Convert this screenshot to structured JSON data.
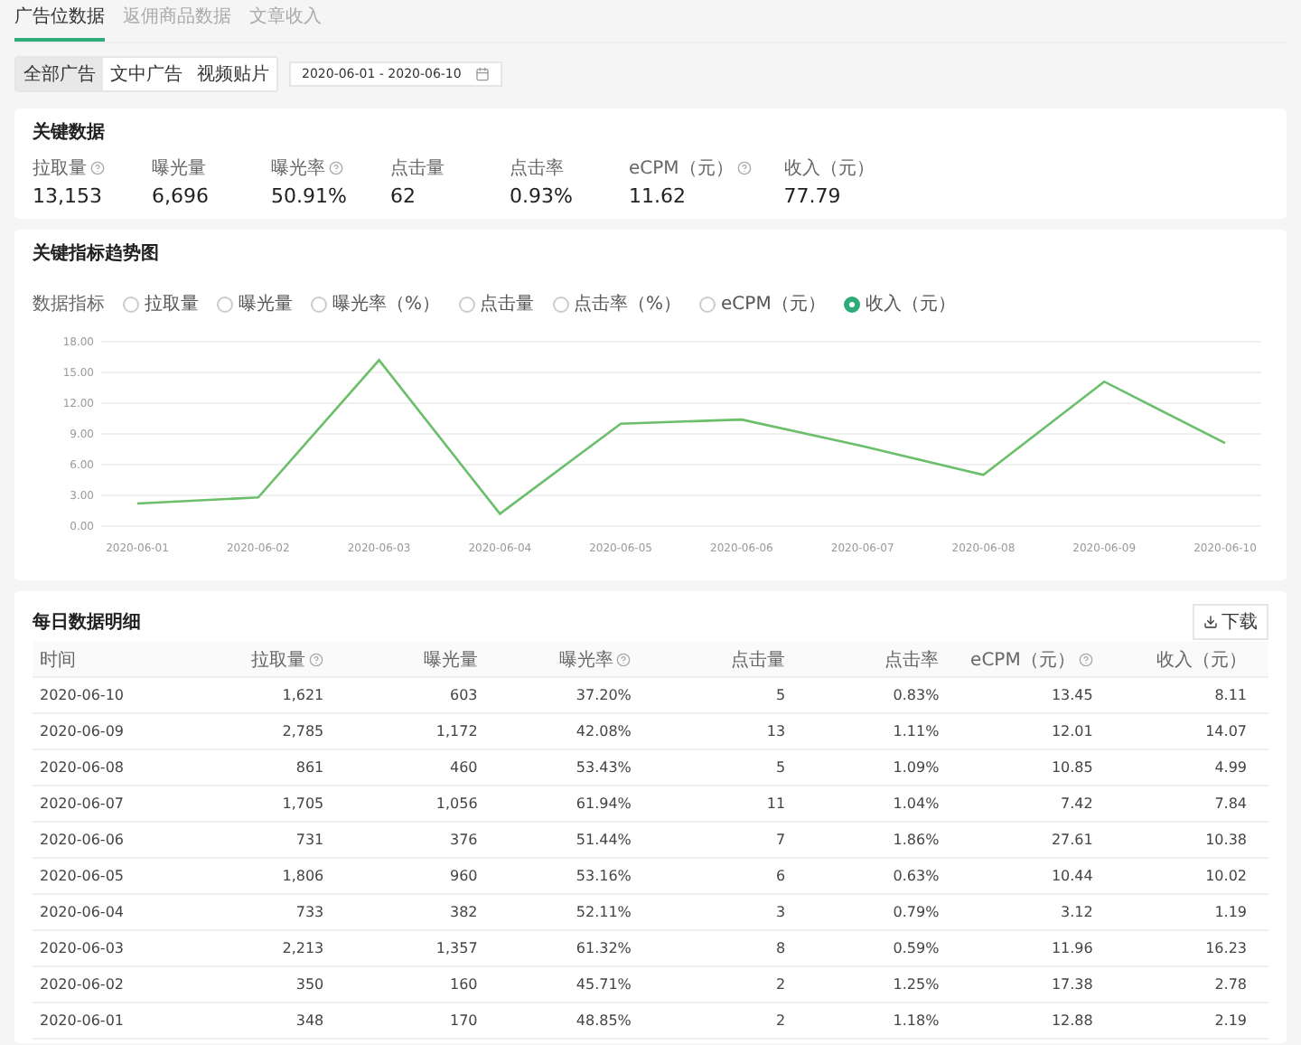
{
  "tabs": [
    {
      "label": "广告位数据",
      "selected": true
    },
    {
      "label": "返佣商品数据",
      "selected": false
    },
    {
      "label": "文章收入",
      "selected": false
    }
  ],
  "filters": {
    "ad_types": [
      {
        "label": "全部广告",
        "selected": true
      },
      {
        "label": "文中广告",
        "selected": false
      },
      {
        "label": "视频贴片",
        "selected": false
      }
    ],
    "date_range": "2020-06-01 - 2020-06-10"
  },
  "key_data": {
    "title": "关键数据",
    "metrics": [
      {
        "label": "拉取量",
        "help": true,
        "value": "13,153"
      },
      {
        "label": "曝光量",
        "help": false,
        "value": "6,696"
      },
      {
        "label": "曝光率",
        "help": true,
        "value": "50.91%"
      },
      {
        "label": "点击量",
        "help": false,
        "value": "62"
      },
      {
        "label": "点击率",
        "help": false,
        "value": "0.93%"
      },
      {
        "label": "eCPM（元）",
        "help": true,
        "value": "11.62"
      },
      {
        "label": "收入（元）",
        "help": false,
        "value": "77.79"
      }
    ]
  },
  "trend": {
    "title": "关键指标趋势图",
    "indicator_label": "数据指标",
    "indicators": [
      {
        "label": "拉取量",
        "selected": false
      },
      {
        "label": "曝光量",
        "selected": false
      },
      {
        "label": "曝光率（%）",
        "selected": false
      },
      {
        "label": "点击量",
        "selected": false
      },
      {
        "label": "点击率（%）",
        "selected": false
      },
      {
        "label": "eCPM（元）",
        "selected": false
      },
      {
        "label": "收入（元）",
        "selected": true
      }
    ],
    "chart_data": {
      "type": "line",
      "categories": [
        "2020-06-01",
        "2020-06-02",
        "2020-06-03",
        "2020-06-04",
        "2020-06-05",
        "2020-06-06",
        "2020-06-07",
        "2020-06-08",
        "2020-06-09",
        "2020-06-10"
      ],
      "grid": true,
      "series": [
        {
          "color": "#6cbf6a",
          "values": [
            2.2,
            2.8,
            16.2,
            1.2,
            10.0,
            10.4,
            7.8,
            5.0,
            14.1,
            8.1
          ]
        }
      ],
      "ylim": [
        0,
        18
      ],
      "yticks": [
        {
          "value": 0,
          "label": "0.00"
        },
        {
          "value": 3,
          "label": "3.00"
        },
        {
          "value": 6,
          "label": "6.00"
        },
        {
          "value": 9,
          "label": "9.00"
        },
        {
          "value": 12,
          "label": "12.00"
        },
        {
          "value": 15,
          "label": "15.00"
        },
        {
          "value": 18,
          "label": "18.00"
        }
      ]
    }
  },
  "daily": {
    "title": "每日数据明细",
    "download": "下载",
    "columns": [
      {
        "label": "时间",
        "help": false
      },
      {
        "label": "拉取量",
        "help": true
      },
      {
        "label": "曝光量",
        "help": false
      },
      {
        "label": "曝光率",
        "help": true
      },
      {
        "label": "点击量",
        "help": false
      },
      {
        "label": "点击率",
        "help": false
      },
      {
        "label": "eCPM（元）",
        "help": true
      },
      {
        "label": "收入（元）",
        "help": false
      }
    ],
    "rows": [
      [
        "2020-06-10",
        "1,621",
        "603",
        "37.20%",
        "5",
        "0.83%",
        "13.45",
        "8.11"
      ],
      [
        "2020-06-09",
        "2,785",
        "1,172",
        "42.08%",
        "13",
        "1.11%",
        "12.01",
        "14.07"
      ],
      [
        "2020-06-08",
        "861",
        "460",
        "53.43%",
        "5",
        "1.09%",
        "10.85",
        "4.99"
      ],
      [
        "2020-06-07",
        "1,705",
        "1,056",
        "61.94%",
        "11",
        "1.04%",
        "7.42",
        "7.84"
      ],
      [
        "2020-06-06",
        "731",
        "376",
        "51.44%",
        "7",
        "1.86%",
        "27.61",
        "10.38"
      ],
      [
        "2020-06-05",
        "1,806",
        "960",
        "53.16%",
        "6",
        "0.63%",
        "10.44",
        "10.02"
      ],
      [
        "2020-06-04",
        "733",
        "382",
        "52.11%",
        "3",
        "0.79%",
        "3.12",
        "1.19"
      ],
      [
        "2020-06-03",
        "2,213",
        "1,357",
        "61.32%",
        "8",
        "0.59%",
        "11.96",
        "16.23"
      ],
      [
        "2020-06-02",
        "350",
        "160",
        "45.71%",
        "2",
        "1.25%",
        "17.38",
        "2.78"
      ],
      [
        "2020-06-01",
        "348",
        "170",
        "48.85%",
        "2",
        "1.18%",
        "12.88",
        "2.19"
      ]
    ]
  }
}
